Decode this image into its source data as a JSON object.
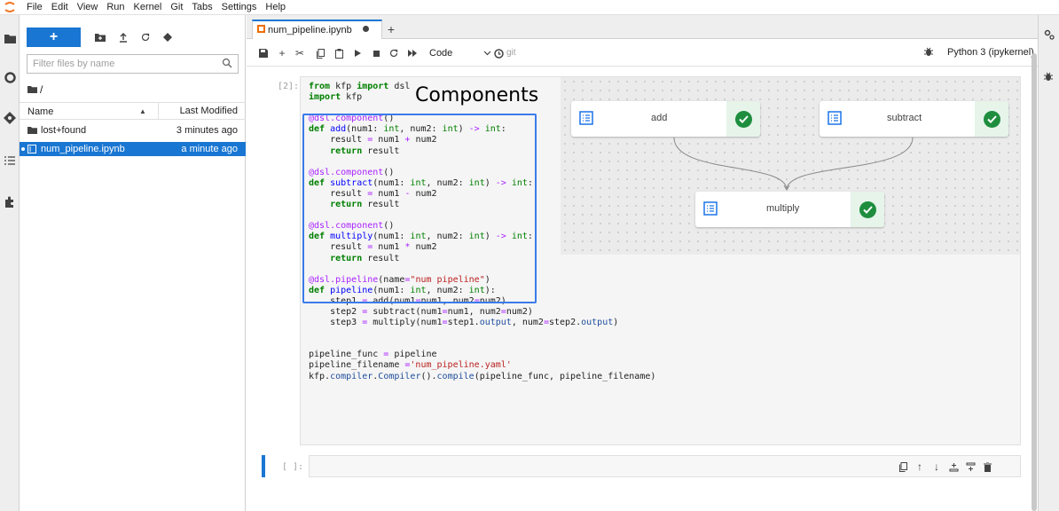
{
  "menubar": {
    "items": [
      "File",
      "Edit",
      "View",
      "Run",
      "Kernel",
      "Git",
      "Tabs",
      "Settings",
      "Help"
    ]
  },
  "filebrowser": {
    "new_label": "+",
    "filter_placeholder": "Filter files by name",
    "breadcrumb": "/",
    "col_name": "Name",
    "col_modified": "Last Modified",
    "files": [
      {
        "name": "lost+found",
        "modified": "3 minutes ago",
        "type": "folder"
      },
      {
        "name": "num_pipeline.ipynb",
        "modified": "a minute ago",
        "type": "notebook"
      }
    ]
  },
  "tabs": [
    {
      "label": "num_pipeline.ipynb"
    }
  ],
  "notebook_toolbar": {
    "cell_type": "Code",
    "git_label": "git",
    "kernel": "Python 3 (ipykernel)"
  },
  "cell1": {
    "prompt": "[2]:",
    "annotation": "Components"
  },
  "cell2": {
    "prompt": "[ ]:"
  },
  "graph": {
    "nodes": [
      {
        "label": "add",
        "status": "succeeded"
      },
      {
        "label": "subtract",
        "status": "succeeded"
      },
      {
        "label": "multiply",
        "status": "succeeded"
      }
    ]
  },
  "colors": {
    "accent": "#1976d2",
    "highlight_box": "#3b7bea",
    "success": "#1e8e3e"
  }
}
